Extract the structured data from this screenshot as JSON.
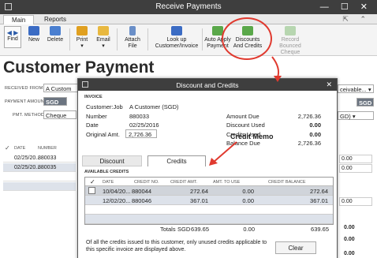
{
  "window": {
    "title": "Receive Payments",
    "controls": "— ☐ ✕"
  },
  "tabs": [
    {
      "label": "Main"
    },
    {
      "label": "Reports"
    }
  ],
  "tab_icons": "⇱ ⌃",
  "toolbar": {
    "find": "Find",
    "new": "New",
    "delete": "Delete",
    "print": "Print",
    "email": "Email",
    "attach": "Attach File",
    "lookup": "Look up Customer/Invoice",
    "autoapply": "Auto Apply Payment",
    "discounts": "Discounts And Credits",
    "record_bounced": "Record Bounced Cheque"
  },
  "page_title": "Customer Payment",
  "form": {
    "received_from_label": "RECEIVED FROM",
    "received_from_value": "A Custom",
    "payment_amount_label": "PAYMENT AMOUNT",
    "payment_amount_value": "SGD",
    "pmt_method_label": "PMT. METHOD",
    "pmt_method_value": "Cheque",
    "right_receivable": "ceivable...",
    "right_sgd": "SGD",
    "right_gd": "GD)"
  },
  "bg_grid": {
    "headers": [
      "DATE",
      "NUMBER"
    ],
    "rows": [
      {
        "date": "02/25/20...",
        "number": "880033"
      },
      {
        "date": "02/25/20...",
        "number": "880035"
      }
    ],
    "right_values": [
      "0.00",
      "0.00",
      "0.00",
      "0.00",
      "0.00",
      "0.00"
    ]
  },
  "modal": {
    "title": "Discount and Credits",
    "invoice_section": "INVOICE",
    "customer_job_label": "Customer:Job",
    "customer_job_value": "A Customer  (SGD)",
    "number_label": "Number",
    "number_value": "880033",
    "date_label": "Date",
    "date_value": "02/25/2016",
    "orig_amt_label": "Original Amt.",
    "orig_amt_value": "2,726.36",
    "amount_due_label": "Amount Due",
    "amount_due_value": "2,726.36",
    "discount_used_label": "Discount Used",
    "discount_used_value": "0.00",
    "credits_used_label": "Credits Used",
    "credits_used_value": "0.00",
    "balance_due_label": "Balance Due",
    "balance_due_value": "2,726.36",
    "tab_discount": "Discount",
    "tab_credits": "Credits",
    "annotation": "Credit Memo",
    "available_credits": "AVAILABLE CREDITS",
    "columns": [
      "✓",
      "DATE",
      "CREDIT NO.",
      "CREDIT AMT.",
      "AMT. TO USE",
      "CREDIT BALANCE"
    ],
    "rows": [
      {
        "date": "10/04/20...",
        "credit_no": "880044",
        "credit_amt": "272.64",
        "amt_to_use": "0.00",
        "credit_balance": "272.64"
      },
      {
        "date": "12/02/20...",
        "credit_no": "880046",
        "credit_amt": "367.01",
        "amt_to_use": "0.00",
        "credit_balance": "367.01"
      }
    ],
    "totals_label": "Totals",
    "totals_currency": "SGD",
    "totals_credit_amt": "639.65",
    "totals_amt_to_use": "0.00",
    "totals_credit_balance": "639.65",
    "note": "Of all the credits issued to this customer, only unused credits applicable to this specific invoice are displayed above.",
    "clear_label": "Clear"
  },
  "colors": {
    "annotation": "#e03a2f",
    "titlebar": "#3e3e3e"
  }
}
